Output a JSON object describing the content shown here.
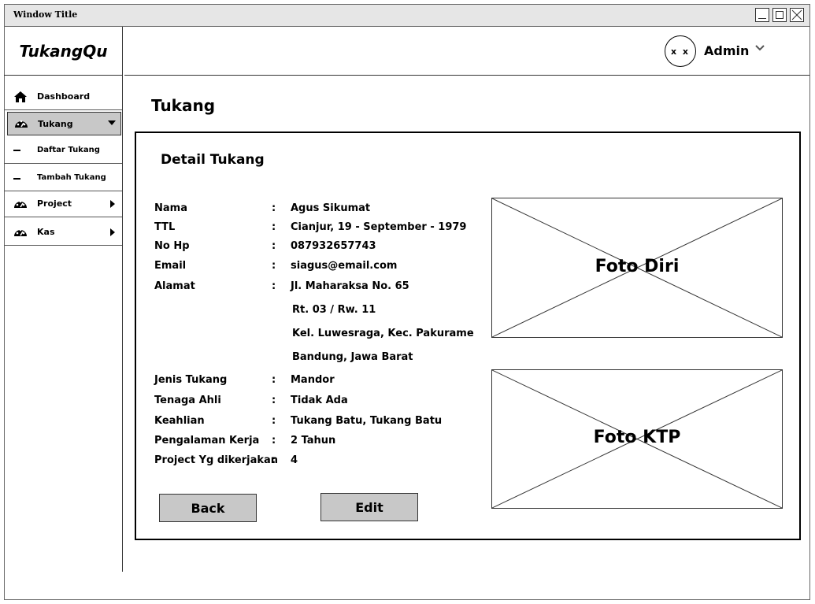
{
  "window": {
    "title": "Window Title"
  },
  "brand": "TukangQu",
  "sidebar": {
    "items": [
      {
        "label": "Dashboard",
        "icon": "home-icon"
      },
      {
        "label": "Tukang",
        "icon": "gauge-icon"
      },
      {
        "label": "Daftar Tukang",
        "icon": "dash-icon"
      },
      {
        "label": "Tambah Tukang",
        "icon": "dash-icon"
      },
      {
        "label": "Project",
        "icon": "gauge-icon"
      },
      {
        "label": "Kas",
        "icon": "gauge-icon"
      }
    ]
  },
  "header": {
    "avatar_text": "x x",
    "user_name": "Admin"
  },
  "page": {
    "title": "Tukang"
  },
  "detail": {
    "title": "Detail Tukang",
    "separator": ":",
    "fields": [
      {
        "label": "Nama",
        "value": "Agus Sikumat"
      },
      {
        "label": "TTL",
        "value": "Cianjur, 19 - September - 1979"
      },
      {
        "label": "No Hp",
        "value": "087932657743"
      },
      {
        "label": "Email",
        "value": "siagus@email.com"
      },
      {
        "label": "Alamat",
        "value": "Jl. Maharaksa No. 65"
      },
      {
        "label": "Jenis Tukang",
        "value": "Mandor"
      },
      {
        "label": "Tenaga Ahli",
        "value": "Tidak Ada"
      },
      {
        "label": "Keahlian",
        "value": "Tukang Batu, Tukang Batu"
      },
      {
        "label": "Pengalaman Kerja",
        "value": "2 Tahun"
      },
      {
        "label": "Project Yg dikerjakan",
        "value": "4"
      }
    ],
    "address_lines": [
      "Rt. 03 / Rw. 11",
      "Kel. Luwesraga,  Kec. Pakurame",
      "Bandung, Jawa Barat"
    ],
    "buttons": {
      "back": "Back",
      "edit": "Edit"
    },
    "photos": {
      "self": "Foto Diri",
      "id_card": "Foto KTP"
    }
  }
}
